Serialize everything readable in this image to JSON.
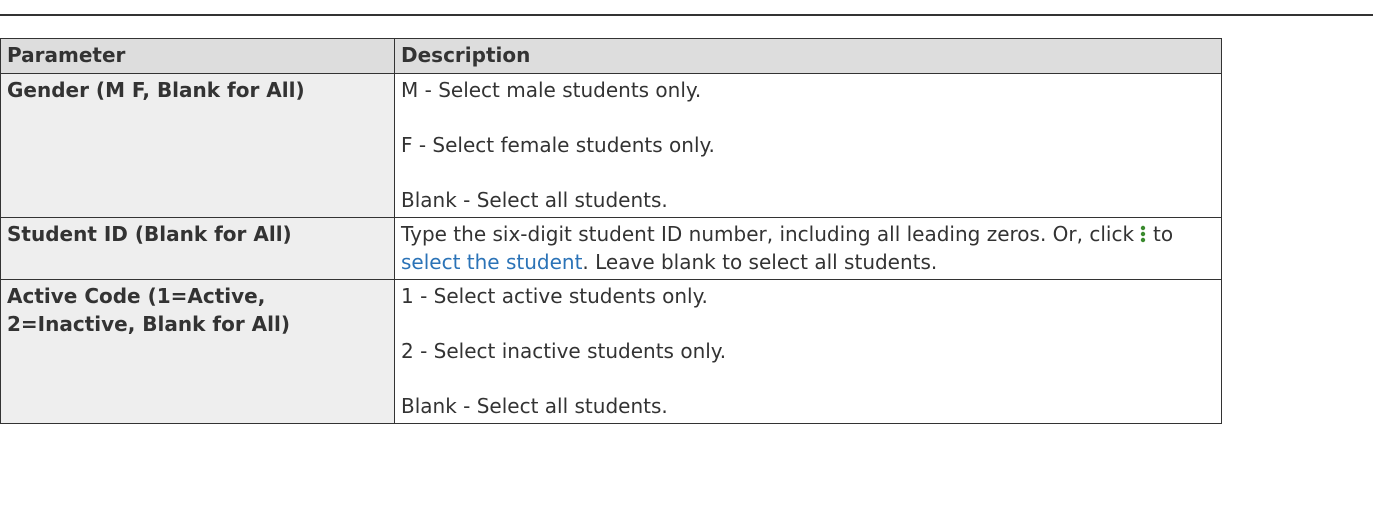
{
  "table": {
    "headers": {
      "parameter": "Parameter",
      "description": "Description"
    },
    "rows": [
      {
        "parameter": "Gender (M F, Blank for All)",
        "lines": [
          "M - Select male students only.",
          "F - Select female students only.",
          "Blank - Select all students."
        ]
      },
      {
        "parameter": "Student ID (Blank for All)",
        "text_before_icon": "Type the six-digit student ID number, including all leading zeros. Or, click",
        "text_to": "to",
        "link_text": "select the student",
        "text_after_link": ". Leave blank to select all students.",
        "icon": "vertical-ellipsis-icon"
      },
      {
        "parameter_line1": "Active Code (1=Active,",
        "parameter_line2": "2=Inactive, Blank for All)",
        "lines": [
          "1 - Select active students only.",
          "2 - Select inactive students only.",
          "Blank - Select all students."
        ]
      }
    ]
  },
  "colors": {
    "link": "#2b73b7",
    "icon": "#3a8a2e",
    "header_bg": "#dddddd",
    "param_bg": "#eeeeee"
  }
}
